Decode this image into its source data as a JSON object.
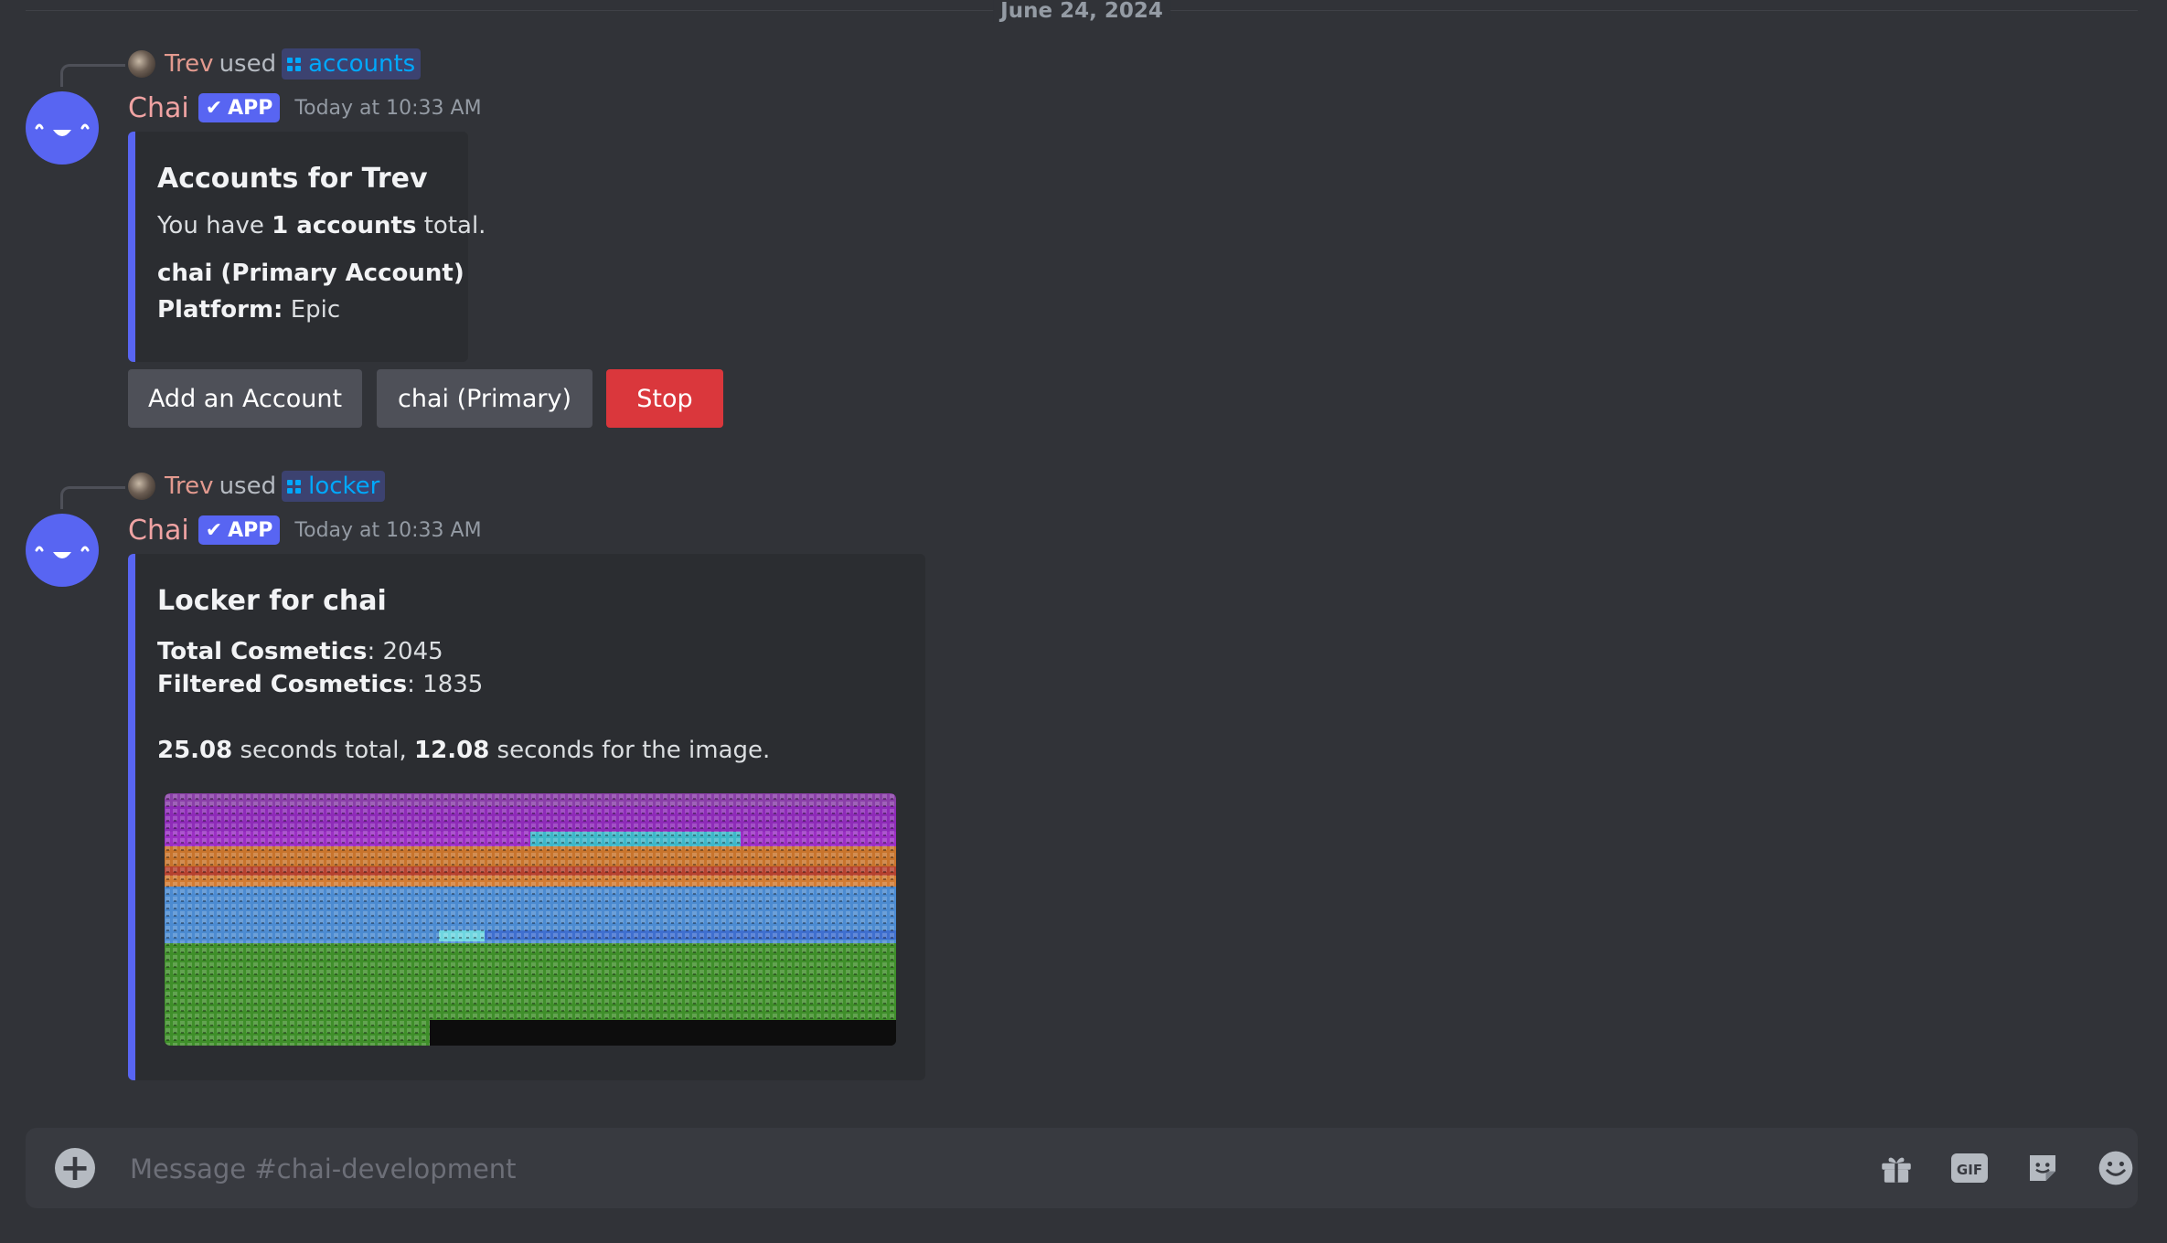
{
  "date_divider": "June 24, 2024",
  "messages": [
    {
      "command_user": "Trev",
      "command_used": "used",
      "command_name": "accounts",
      "author": "Chai",
      "badge": "APP",
      "timestamp": "Today at 10:33 AM",
      "embed": {
        "title": "Accounts for Trev",
        "line1_pre": "You have ",
        "line1_bold": "1 accounts",
        "line1_post": " total.",
        "account_name": "chai (Primary Account)",
        "platform_label": "Platform:",
        "platform_value": " Epic"
      },
      "buttons": [
        "Add an Account",
        "chai (Primary)",
        "Stop"
      ]
    },
    {
      "command_user": "Trev",
      "command_used": "used",
      "command_name": "locker",
      "author": "Chai",
      "badge": "APP",
      "timestamp": "Today at 10:33 AM",
      "embed": {
        "title": "Locker for chai",
        "total_label": "Total Cosmetics",
        "total_value": ": 2045",
        "filtered_label": "Filtered Cosmetics",
        "filtered_value": ": 1835",
        "time_total": "25.08",
        "time_total_text": " seconds total, ",
        "time_image": "12.08",
        "time_image_text": " seconds for the image."
      }
    }
  ],
  "composer": {
    "placeholder": "Message #chai-development"
  },
  "icons": {
    "plus": "add-circle-icon",
    "gift": "gift-icon",
    "gif": "gif-icon",
    "sticker": "sticker-icon",
    "emoji": "emoji-icon"
  },
  "colors": {
    "background": "#313338",
    "brand": "#5865f2",
    "danger": "#da373c",
    "link": "#00a8fc"
  }
}
